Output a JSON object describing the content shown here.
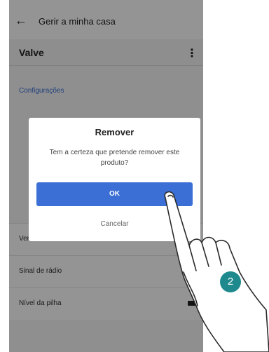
{
  "header": {
    "title": "Gerir a minha casa"
  },
  "device": {
    "name": "Valve"
  },
  "section": {
    "label": "Configurações"
  },
  "rows": [
    {
      "label": "Versão do firmware"
    },
    {
      "label": "Sinal de rádio"
    },
    {
      "label": "Nível da pilha"
    }
  ],
  "dialog": {
    "title": "Remover",
    "message": "Tem a certeza que pretende remover este produto?",
    "ok_label": "OK",
    "cancel_label": "Cancelar"
  },
  "step": {
    "number": "2"
  },
  "colors": {
    "accent": "#3b6fd6",
    "step_badge": "#1f8a8d"
  },
  "icons": {
    "back": "arrow-left-icon",
    "menu": "kebab-menu-icon",
    "battery": "battery-icon"
  }
}
